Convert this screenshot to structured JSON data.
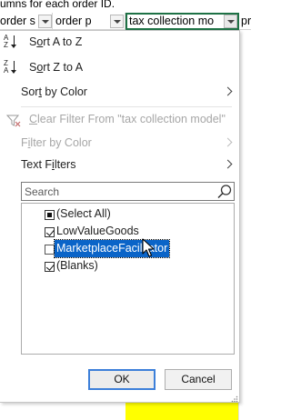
{
  "sheet": {
    "top_row_text": "umns for each order ID.",
    "top_row_right": "",
    "headers": [
      {
        "label": "order s"
      },
      {
        "label": "order p"
      },
      {
        "label": "tax collection mo"
      },
      {
        "label": "pr"
      }
    ],
    "highlight_color": "#ffff00"
  },
  "filter_menu": {
    "sort_az": "Sort A to Z",
    "sort_az_icon": "sort-ascending-icon",
    "sort_za": "Sort Z to A",
    "sort_za_icon": "sort-descending-icon",
    "sort_by_color": "Sort by Color",
    "clear_filter": "Clear Filter From \"tax collection model\"",
    "filter_by_color": "Filter by Color",
    "text_filters": "Text Filters",
    "search_placeholder": "Search",
    "values": [
      {
        "label": "(Select All)",
        "state": "partial"
      },
      {
        "label": "LowValueGoods",
        "state": "checked"
      },
      {
        "label": "MarketplaceFacilitator",
        "state": "unchecked"
      },
      {
        "label": "(Blanks)",
        "state": "checked"
      }
    ],
    "ok_label": "OK",
    "cancel_label": "Cancel"
  }
}
